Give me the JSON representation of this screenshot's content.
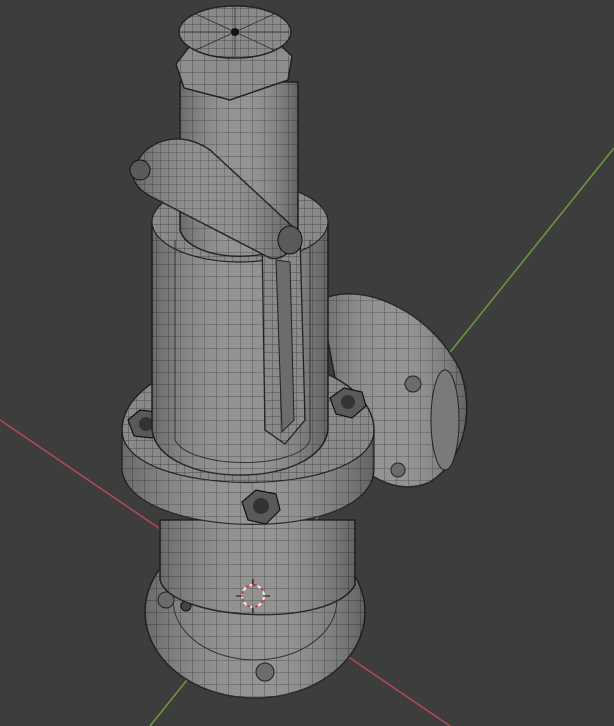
{
  "viewport": {
    "background": "#3d3d3d",
    "x_axis_color": "#b64a52",
    "y_axis_color": "#6f9a3a",
    "mesh_fill": "#8f8f8f",
    "mesh_shadow": "#6a6a6a",
    "wire_color": "#2a2a2a",
    "cursor_icon": "3d-cursor-icon"
  },
  "object": {
    "name_icon": "safety-valve-mesh-icon",
    "bolts_icon": "hex-nut-icon"
  }
}
